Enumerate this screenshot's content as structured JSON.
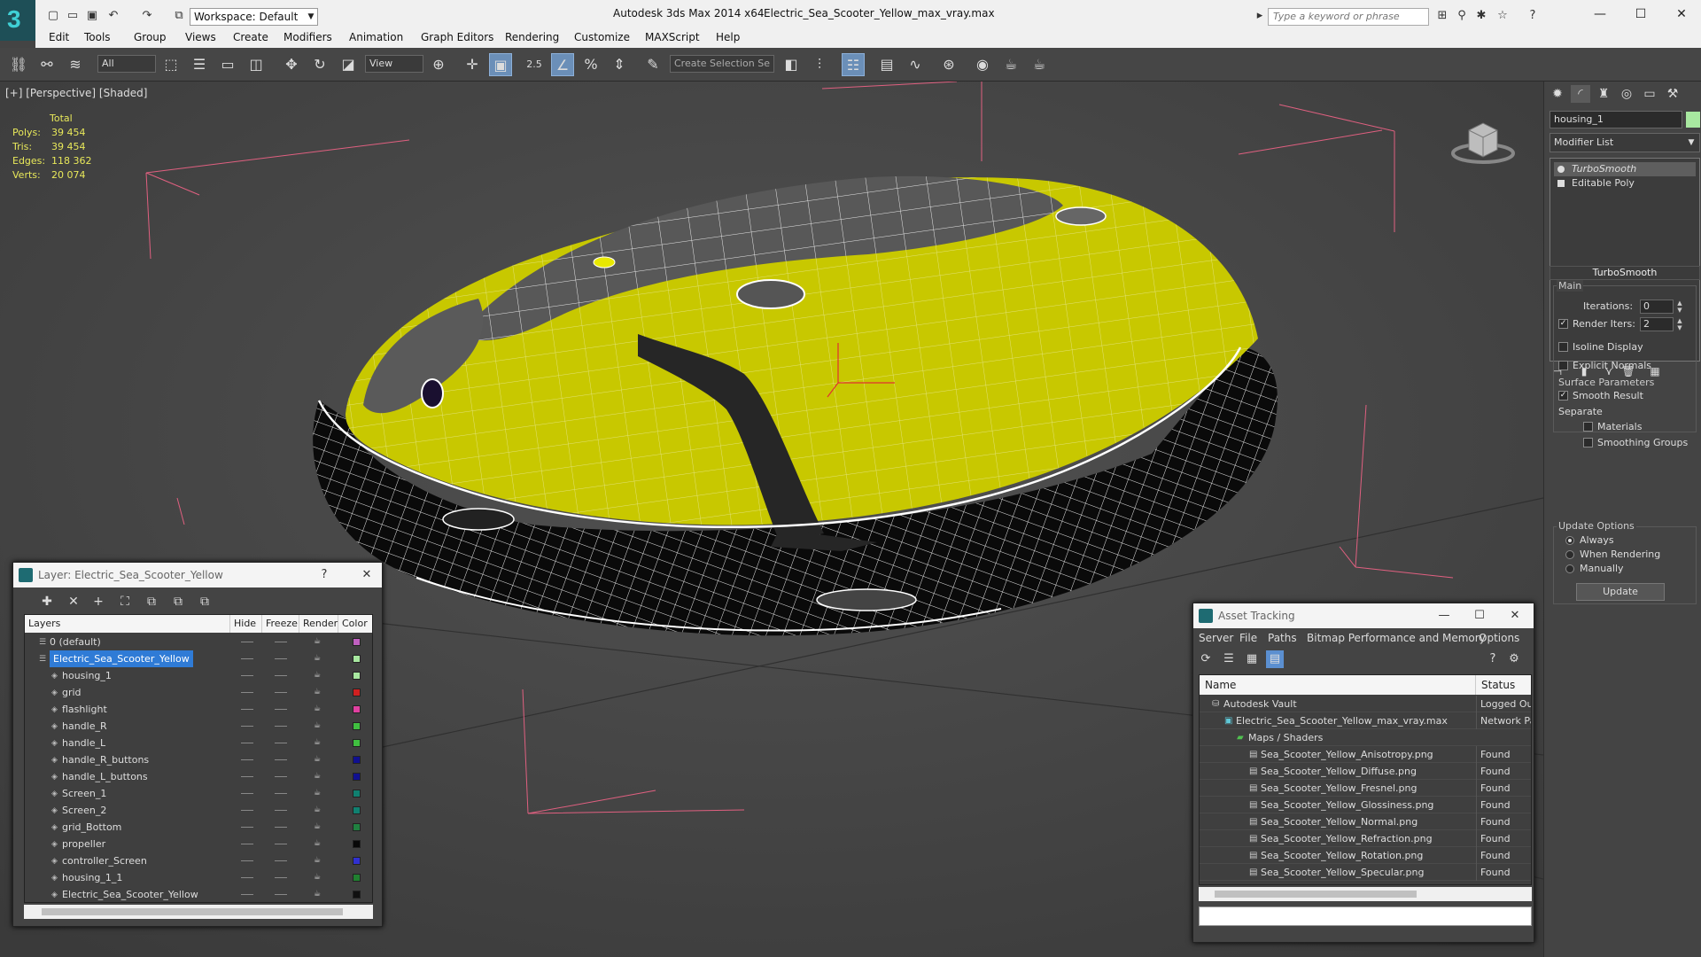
{
  "titlebar": {
    "app_name": "Autodesk 3ds Max  2014 x64",
    "file_name": "Electric_Sea_Scooter_Yellow_max_vray.max",
    "workspace": "Workspace: Default",
    "search_placeholder": "Type a keyword or phrase",
    "logo_glyph": "3"
  },
  "menu": [
    "Edit",
    "Tools",
    "Group",
    "Views",
    "Create",
    "Modifiers",
    "Animation",
    "Graph Editors",
    "Rendering",
    "Customize",
    "MAXScript",
    "Help"
  ],
  "toolbar": {
    "selection_filter": "All",
    "reference_coord": "View",
    "selection_set_placeholder": "Create Selection Se",
    "snap_label": "2.5"
  },
  "viewport": {
    "label": "[+] [Perspective] [Shaded]",
    "stats": {
      "header": "Total",
      "rows": [
        {
          "label": "Polys:",
          "value": "39 454"
        },
        {
          "label": "Tris:",
          "value": "39 454"
        },
        {
          "label": "Edges:",
          "value": "118 362"
        },
        {
          "label": "Verts:",
          "value": "20 074"
        }
      ]
    },
    "model_color": "#c8c800",
    "background": "#4a4a4a"
  },
  "command_panel": {
    "object_name": "housing_1",
    "object_color": "#a8e8a0",
    "modifier_list": "Modifier List",
    "stack": [
      "TurboSmooth",
      "Editable Poly"
    ],
    "rollout": "TurboSmooth",
    "main_group": "Main",
    "iterations_label": "Iterations:",
    "iterations_value": "0",
    "render_iters_label": "Render Iters:",
    "render_iters_value": "2",
    "isoline": "Isoline Display",
    "explicit_normals": "Explicit Normals",
    "surface_group": "Surface Parameters",
    "smooth_result": "Smooth Result",
    "separate": "Separate",
    "materials": "Materials",
    "smoothing_groups": "Smoothing Groups",
    "update_group": "Update Options",
    "always": "Always",
    "when_rendering": "When Rendering",
    "manually": "Manually",
    "update_button": "Update"
  },
  "layer_window": {
    "title": "Layer: Electric_Sea_Scooter_Yellow",
    "help": "?",
    "columns": [
      "Layers",
      "Hide",
      "Freeze",
      "Render",
      "Color"
    ],
    "rows": [
      {
        "name": "0 (default)",
        "color": "#c060c0",
        "level": 0
      },
      {
        "name": "Electric_Sea_Scooter_Yellow",
        "color": "#a8e8a0",
        "level": 0,
        "selected": true
      },
      {
        "name": "housing_1",
        "color": "#a8e8a0",
        "level": 1
      },
      {
        "name": "grid",
        "color": "#d02020",
        "level": 1
      },
      {
        "name": "flashlight",
        "color": "#e040a0",
        "level": 1
      },
      {
        "name": "handle_R",
        "color": "#40c040",
        "level": 1
      },
      {
        "name": "handle_L",
        "color": "#40c040",
        "level": 1
      },
      {
        "name": "handle_R_buttons",
        "color": "#101090",
        "level": 1
      },
      {
        "name": "handle_L_buttons",
        "color": "#101090",
        "level": 1
      },
      {
        "name": "Screen_1",
        "color": "#108070",
        "level": 1
      },
      {
        "name": "Screen_2",
        "color": "#108070",
        "level": 1
      },
      {
        "name": "grid_Bottom",
        "color": "#208040",
        "level": 1
      },
      {
        "name": "propeller",
        "color": "#080808",
        "level": 1
      },
      {
        "name": "controller_Screen",
        "color": "#3030d0",
        "level": 1
      },
      {
        "name": "housing_1_1",
        "color": "#208030",
        "level": 1
      },
      {
        "name": "Electric_Sea_Scooter_Yellow",
        "color": "#101010",
        "level": 1
      }
    ]
  },
  "asset_window": {
    "title": "Asset Tracking",
    "menu": [
      "Server",
      "File",
      "Paths",
      "Bitmap Performance and Memory",
      "Options"
    ],
    "columns": [
      "Name",
      "Status"
    ],
    "rows": [
      {
        "name": "Autodesk Vault",
        "status": "Logged Ou",
        "level": 0
      },
      {
        "name": "Electric_Sea_Scooter_Yellow_max_vray.max",
        "status": "Network Pa",
        "level": 1
      },
      {
        "name": "Maps / Shaders",
        "status": "",
        "level": 2
      },
      {
        "name": "Sea_Scooter_Yellow_Anisotropy.png",
        "status": "Found",
        "level": 3
      },
      {
        "name": "Sea_Scooter_Yellow_Diffuse.png",
        "status": "Found",
        "level": 3
      },
      {
        "name": "Sea_Scooter_Yellow_Fresnel.png",
        "status": "Found",
        "level": 3
      },
      {
        "name": "Sea_Scooter_Yellow_Glossiness.png",
        "status": "Found",
        "level": 3
      },
      {
        "name": "Sea_Scooter_Yellow_Normal.png",
        "status": "Found",
        "level": 3
      },
      {
        "name": "Sea_Scooter_Yellow_Refraction.png",
        "status": "Found",
        "level": 3
      },
      {
        "name": "Sea_Scooter_Yellow_Rotation.png",
        "status": "Found",
        "level": 3
      },
      {
        "name": "Sea_Scooter_Yellow_Specular.png",
        "status": "Found",
        "level": 3
      }
    ]
  }
}
